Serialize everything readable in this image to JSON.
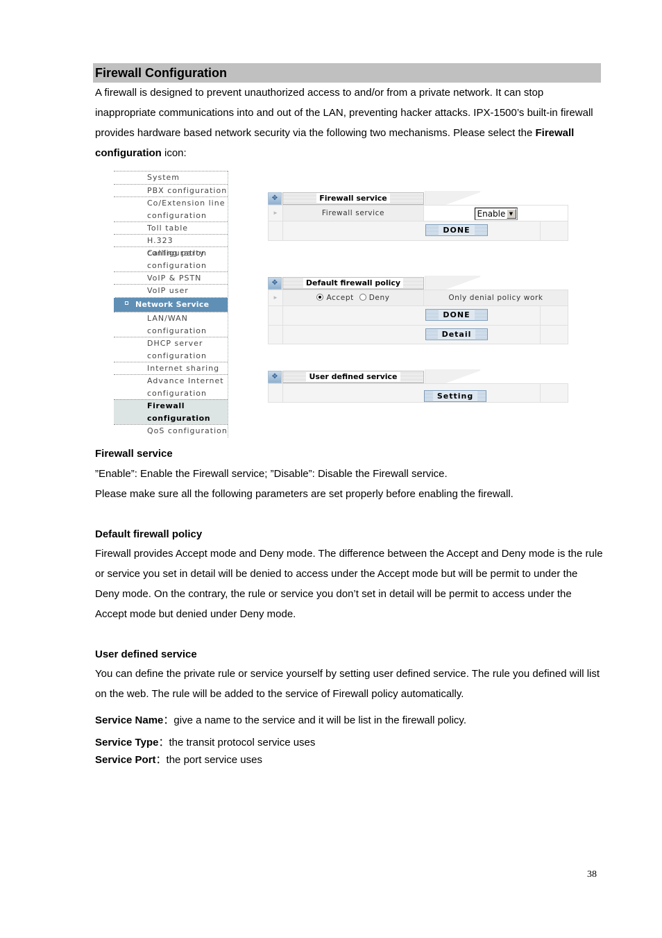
{
  "section_title": "Firewall Configuration",
  "intro": {
    "text": "A firewall is designed to prevent unauthorized access to and/or from a private network. It can stop inappropriate communications into and out of the LAN, preventing hacker attacks. IPX-1500’s built-in firewall provides hardware based network security via the following two mechanisms. Please select the ",
    "bold": "Firewall configuration",
    "tail": " icon:"
  },
  "menu": {
    "items": [
      {
        "label": "System"
      },
      {
        "label": "PBX configuration"
      },
      {
        "label": "Co/Extension line configuration"
      },
      {
        "label": "Toll table"
      },
      {
        "label": "H.323 configuration"
      },
      {
        "label": "Calling party configuration"
      },
      {
        "label": "VoIP & PSTN"
      },
      {
        "label": "VoIP user"
      },
      {
        "label": "Network Service"
      },
      {
        "label": "LAN/WAN configuration"
      },
      {
        "label": "DHCP server configuration"
      },
      {
        "label": "Internet sharing"
      },
      {
        "label": "Advance Internet configuration"
      },
      {
        "label": "Firewall configuration"
      },
      {
        "label": "QoS configuration"
      }
    ],
    "active": "Firewall configuration",
    "group": "Network Service"
  },
  "panels": {
    "firewall_service": {
      "title": "Firewall service",
      "row_label": "Firewall service",
      "select_value": "Enable",
      "done_label": "DONE"
    },
    "default_policy": {
      "title": "Default firewall policy",
      "accept_label": "Accept",
      "deny_label": "Deny",
      "selected": "Accept",
      "note": "Only denial policy work",
      "done_label": "DONE",
      "detail_label": "Detail"
    },
    "user_defined": {
      "title": "User defined service",
      "setting_label": "Setting"
    }
  },
  "sections": {
    "firewall_service": {
      "heading": "Firewall service",
      "line1": "”Enable”: Enable the Firewall service; ”Disable”: Disable the Firewall service.",
      "line2": "Please make sure all the following parameters are set properly before enabling the firewall."
    },
    "default_policy": {
      "heading": "Default firewall policy",
      "text": "Firewall provides Accept mode and Deny mode. The difference between the Accept and Deny mode is the rule or service you set in detail will be denied to access under the Accept mode but will be permit to under the Deny mode. On the contrary, the rule or service you don’t set in detail will be permit to access under the Accept mode but denied under Deny mode."
    },
    "user_defined": {
      "heading": "User defined service",
      "text": "You can define the private rule or service yourself by setting user defined service. The rule you defined will list on the web. The rule will be added to the service of Firewall policy automatically.",
      "service_name_label": "Service Name",
      "service_name_desc": "：give a name to the service and it will be list in the firewall policy.",
      "service_type_label": "Service Type",
      "service_type_desc": "：the transit protocol service uses",
      "service_port_label": "Service Port",
      "service_port_desc": "：the port service uses"
    }
  },
  "page_number": "38"
}
